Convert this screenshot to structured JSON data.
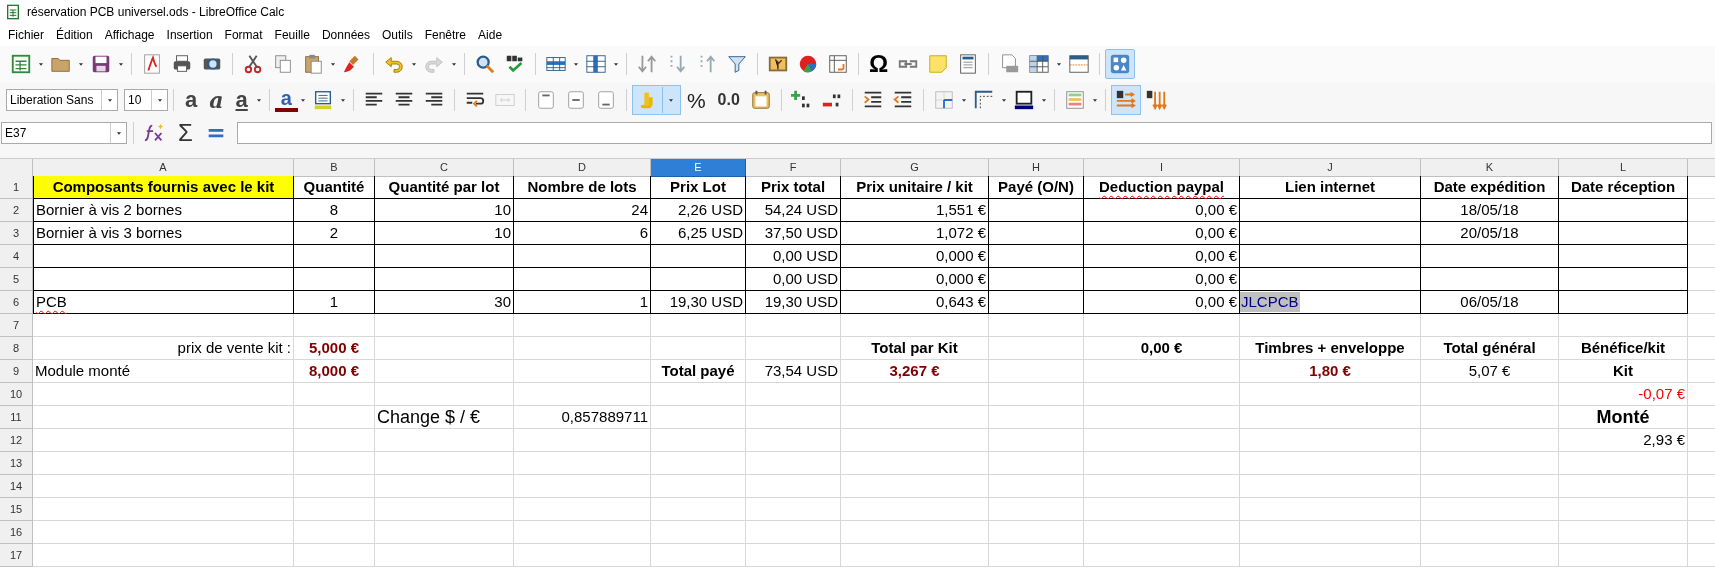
{
  "window": {
    "title": "réservation PCB universel.ods - LibreOffice Calc"
  },
  "menu": [
    "Fichier",
    "Édition",
    "Affichage",
    "Insertion",
    "Format",
    "Feuille",
    "Données",
    "Outils",
    "Fenêtre",
    "Aide"
  ],
  "standard_toolbar": {
    "redo": {
      "disabled": true
    },
    "special_character_label": "Ω",
    "shapes": {
      "on": true
    }
  },
  "formatting_toolbar": {
    "font_name": "Liberation Sans",
    "font_size": "10",
    "bold_label": "a",
    "italic_label": "a",
    "underline_label": "a",
    "font_color_label": "a",
    "merge_cells": {
      "disabled": true
    },
    "currency": {
      "on": true
    },
    "percent_label": "%",
    "decimal_label": "0.0",
    "text_flow": {
      "on": true
    }
  },
  "formula_bar": {
    "name_box": "E37",
    "sum_label": "Σ"
  },
  "columns": [
    {
      "label": "A",
      "selected": false
    },
    {
      "label": "B",
      "selected": false
    },
    {
      "label": "C",
      "selected": false
    },
    {
      "label": "D",
      "selected": false
    },
    {
      "label": "E",
      "selected": true
    },
    {
      "label": "F",
      "selected": false
    },
    {
      "label": "G",
      "selected": false
    },
    {
      "label": "H",
      "selected": false
    },
    {
      "label": "I",
      "selected": false
    },
    {
      "label": "J",
      "selected": false
    },
    {
      "label": "K",
      "selected": false
    },
    {
      "label": "L",
      "selected": false
    }
  ],
  "rows": [
    {
      "number": "1",
      "boxed": true,
      "cells": {
        "A": {
          "kind": "highlight",
          "text": "Composants fournis avec le kit"
        },
        "B": {
          "kind": "header",
          "text": "Quantité"
        },
        "C": {
          "kind": "header",
          "text": "Quantité par lot"
        },
        "D": {
          "kind": "header",
          "text": "Nombre de lots"
        },
        "E": {
          "kind": "header",
          "text": "Prix Lot"
        },
        "F": {
          "kind": "header",
          "text": "Prix total"
        },
        "G": {
          "kind": "header",
          "text": "Prix unitaire / kit"
        },
        "H": {
          "kind": "header",
          "text": "Payé (O/N)"
        },
        "I": {
          "kind": "header",
          "text": "Deduction paypal",
          "misspelled": true
        },
        "J": {
          "kind": "header",
          "text": "Lien internet"
        },
        "K": {
          "kind": "header",
          "text": "Date expédition"
        },
        "L": {
          "kind": "header",
          "text": "Date réception"
        }
      }
    },
    {
      "number": "2",
      "boxed": true,
      "cells": {
        "A": {
          "kind": "text",
          "text": "Bornier à vis 2 bornes"
        },
        "B": {
          "kind": "center",
          "text": "8"
        },
        "C": {
          "kind": "number",
          "text": "10"
        },
        "D": {
          "kind": "number",
          "text": "24"
        },
        "E": {
          "kind": "number",
          "text": "2,26 USD"
        },
        "F": {
          "kind": "number",
          "text": "54,24 USD"
        },
        "G": {
          "kind": "number",
          "text": "1,551 €"
        },
        "I": {
          "kind": "number",
          "text": "0,00 €"
        },
        "K": {
          "kind": "center",
          "text": "18/05/18"
        }
      }
    },
    {
      "number": "3",
      "boxed": true,
      "cells": {
        "A": {
          "kind": "text",
          "text": "Bornier à vis 3 bornes"
        },
        "B": {
          "kind": "center",
          "text": "2"
        },
        "C": {
          "kind": "number",
          "text": "10"
        },
        "D": {
          "kind": "number",
          "text": "6"
        },
        "E": {
          "kind": "number",
          "text": "6,25 USD"
        },
        "F": {
          "kind": "number",
          "text": "37,50 USD"
        },
        "G": {
          "kind": "number",
          "text": "1,072 €"
        },
        "I": {
          "kind": "number",
          "text": "0,00 €"
        },
        "K": {
          "kind": "center",
          "text": "20/05/18"
        }
      }
    },
    {
      "number": "4",
      "boxed": true,
      "cells": {
        "F": {
          "kind": "number",
          "text": "0,00 USD"
        },
        "G": {
          "kind": "number",
          "text": "0,000 €"
        },
        "I": {
          "kind": "number",
          "text": "0,00 €"
        }
      }
    },
    {
      "number": "5",
      "boxed": true,
      "cells": {
        "F": {
          "kind": "number",
          "text": "0,00 USD"
        },
        "G": {
          "kind": "number",
          "text": "0,000 €"
        },
        "I": {
          "kind": "number",
          "text": "0,00 €"
        }
      }
    },
    {
      "number": "6",
      "boxed": true,
      "cells": {
        "A": {
          "kind": "text",
          "text": "PCB",
          "misspelled": true
        },
        "B": {
          "kind": "center",
          "text": "1"
        },
        "C": {
          "kind": "number",
          "text": "30"
        },
        "D": {
          "kind": "number",
          "text": "1"
        },
        "E": {
          "kind": "number",
          "text": "19,30 USD"
        },
        "F": {
          "kind": "number",
          "text": "19,30 USD"
        },
        "G": {
          "kind": "number",
          "text": "0,643 €"
        },
        "I": {
          "kind": "number",
          "text": "0,00 €"
        },
        "J": {
          "kind": "link",
          "text": "JLCPCB"
        },
        "K": {
          "kind": "center",
          "text": "06/05/18"
        }
      }
    },
    {
      "number": "7",
      "boxed": false
    },
    {
      "number": "8",
      "boxed": false,
      "cells": {
        "A": {
          "kind": "label_right",
          "text": "prix de vente kit :"
        },
        "B": {
          "kind": "price",
          "text": "5,000 €"
        },
        "G": {
          "kind": "bold",
          "text": "Total par Kit"
        },
        "I": {
          "kind": "bold",
          "text": "0,00 €"
        },
        "J": {
          "kind": "bold",
          "text": "Timbres + enveloppe"
        },
        "K": {
          "kind": "bold",
          "text": "Total général"
        },
        "L": {
          "kind": "bold",
          "text": "Bénéfice/kit"
        }
      }
    },
    {
      "number": "9",
      "boxed": false,
      "cells": {
        "A": {
          "kind": "text",
          "text": "Module monté"
        },
        "B": {
          "kind": "price",
          "text": "8,000 €"
        },
        "E": {
          "kind": "bold",
          "text": "Total payé"
        },
        "F": {
          "kind": "number",
          "text": "73,54 USD"
        },
        "G": {
          "kind": "price",
          "text": "3,267 €"
        },
        "J": {
          "kind": "price",
          "text": "1,80 €"
        },
        "K": {
          "kind": "center",
          "text": "5,07 €"
        },
        "L": {
          "kind": "bold",
          "text": "Kit"
        }
      }
    },
    {
      "number": "10",
      "boxed": false,
      "cells": {
        "L": {
          "kind": "negative",
          "text": "-0,07 €"
        }
      }
    },
    {
      "number": "11",
      "boxed": false,
      "cells": {
        "C": {
          "kind": "large",
          "text": "Change $ / €"
        },
        "D": {
          "kind": "number",
          "text": "0,857889711"
        },
        "L": {
          "kind": "large_bold",
          "text": "Monté"
        }
      }
    },
    {
      "number": "12",
      "boxed": false,
      "cells": {
        "L": {
          "kind": "number",
          "text": "2,93 €"
        }
      }
    },
    {
      "number": "13",
      "boxed": false
    },
    {
      "number": "14",
      "boxed": false
    },
    {
      "number": "15",
      "boxed": false
    },
    {
      "number": "16",
      "boxed": false
    },
    {
      "number": "17",
      "boxed": false
    }
  ]
}
